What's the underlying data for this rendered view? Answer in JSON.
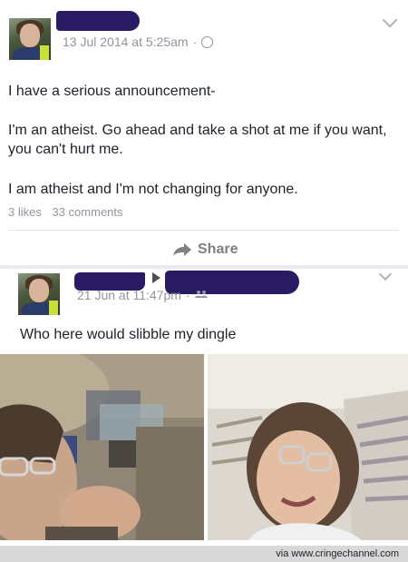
{
  "post1": {
    "timestamp": "13 Jul 2014 at 5:25am",
    "separator": "·",
    "privacy_icon": "globe-icon",
    "menu_icon": "chevron-down-icon",
    "line1": "I have a serious announcement-",
    "line2": "I'm an atheist. Go ahead and take a shot at me if you want, you can't hurt me.",
    "line3": "I am atheist and I'm not changing for anyone.",
    "likes": "3 likes",
    "comments": "33 comments",
    "share_label": "Share"
  },
  "post2": {
    "timestamp": "21 Jun at 11:47pm",
    "separator": "·",
    "privacy_icon": "friends-icon",
    "text": "Who here would slibble my dingle"
  },
  "footer": {
    "watermark": "via www.cringechannel.com"
  }
}
